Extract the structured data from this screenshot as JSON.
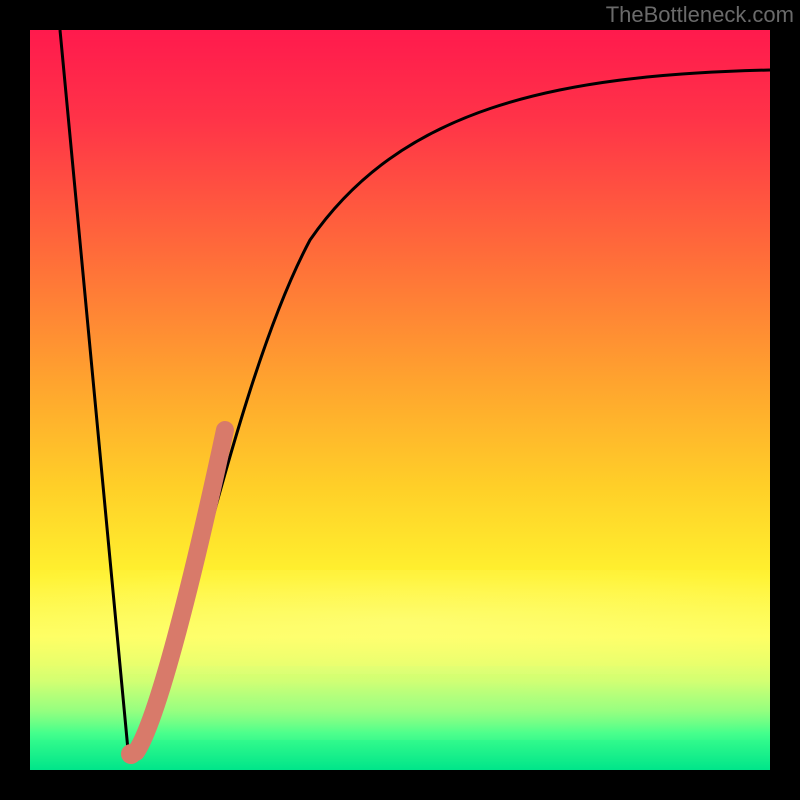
{
  "watermark": "TheBottleneck.com",
  "colors": {
    "frame": "#000000",
    "curve": "#000000",
    "highlight": "#d87a6a",
    "gradient_top": "#ff1a4d",
    "gradient_bottom": "#00e58a"
  },
  "chart_data": {
    "type": "line",
    "title": "",
    "xlabel": "",
    "ylabel": "",
    "xlim": [
      0,
      100
    ],
    "ylim": [
      0,
      100
    ],
    "series": [
      {
        "name": "bottleneck-curve",
        "x": [
          0,
          5,
          10,
          13,
          15,
          18,
          20,
          23,
          25,
          28,
          32,
          36,
          40,
          45,
          50,
          56,
          63,
          72,
          82,
          100
        ],
        "y": [
          100,
          62,
          23,
          3,
          1,
          5,
          17,
          33,
          45,
          55,
          65,
          72,
          77,
          81,
          84,
          86.5,
          88.5,
          90,
          91,
          92
        ]
      },
      {
        "name": "highlight-segment",
        "x": [
          14,
          15,
          16,
          17,
          18,
          19,
          20,
          21,
          22,
          23,
          24,
          25
        ],
        "y": [
          1,
          1.5,
          4,
          9,
          15,
          21,
          27,
          32,
          37,
          41,
          44,
          47
        ]
      }
    ],
    "annotations": []
  }
}
